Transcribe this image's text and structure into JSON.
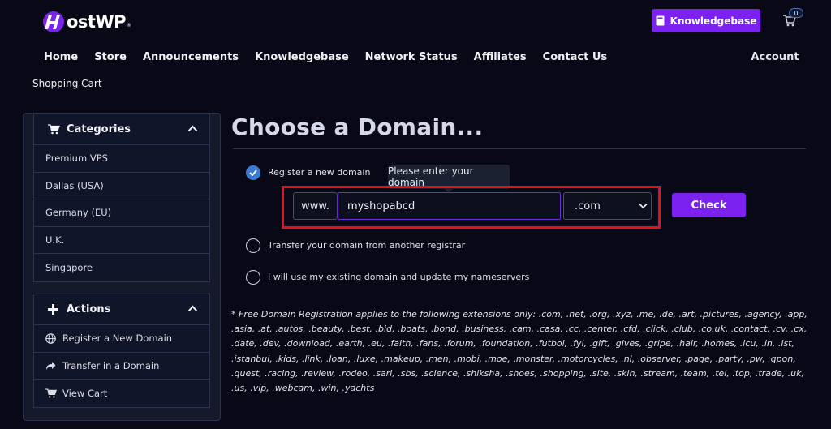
{
  "brand": {
    "logo_text": "ostWP",
    "logo_reg": "®",
    "accent": "#7b22f0"
  },
  "header": {
    "knowledgebase_button": "Knowledgebase",
    "cart_count": "0"
  },
  "nav": {
    "items": [
      "Home",
      "Store",
      "Announcements",
      "Knowledgebase",
      "Network Status",
      "Affiliates",
      "Contact Us"
    ],
    "account": "Account"
  },
  "breadcrumb": "Shopping Cart",
  "sidebar": {
    "categories": {
      "title": "Categories",
      "icon": "cart-icon",
      "items": [
        "Premium VPS",
        "Dallas (USA)",
        "Germany (EU)",
        "U.K.",
        "Singapore"
      ]
    },
    "actions": {
      "title": "Actions",
      "icon": "plus-icon",
      "items": [
        {
          "label": "Register a New Domain",
          "icon": "globe-icon"
        },
        {
          "label": "Transfer in a Domain",
          "icon": "share-icon"
        },
        {
          "label": "View Cart",
          "icon": "cart-icon"
        }
      ]
    }
  },
  "main": {
    "title": "Choose a Domain...",
    "options": [
      {
        "label": "Register a new domain",
        "checked": true
      },
      {
        "label": "Transfer your domain from another registrar",
        "checked": false
      },
      {
        "label": "I will use my existing domain and update my nameservers",
        "checked": false
      }
    ],
    "tooltip": "Please enter your domain",
    "www_prefix": "www.",
    "domain_value": "myshopabcd",
    "tld_selected": ".com",
    "check_button": "Check",
    "highlight_color": "#e0121c",
    "note": "* Free Domain Registration applies to the following extensions only: .com, .net, .org, .xyz, .me, .de, .art, .pictures, .agency, .app, .asia, .at, .autos, .beauty, .best, .bid, .boats, .bond, .business, .cam, .casa, .cc, .center, .cfd, .click, .club, .co.uk, .contact, .cv, .cx, .date, .dev, .download, .earth, .eu, .faith, .fans, .forum, .foundation, .futbol, .fyi, .gift, .gives, .gripe, .hair, .homes, .icu, .in, .ist, .istanbul, .kids, .link, .loan, .luxe, .makeup, .men, .mobi, .moe, .monster, .motorcycles, .nl, .observer, .page, .party, .pw, .qpon, .quest, .racing, .review, .rodeo, .sarl, .sbs, .science, .shiksha, .shoes, .shopping, .site, .skin, .stream, .team, .tel, .top, .trade, .uk, .us, .vip, .webcam, .win, .yachts"
  }
}
